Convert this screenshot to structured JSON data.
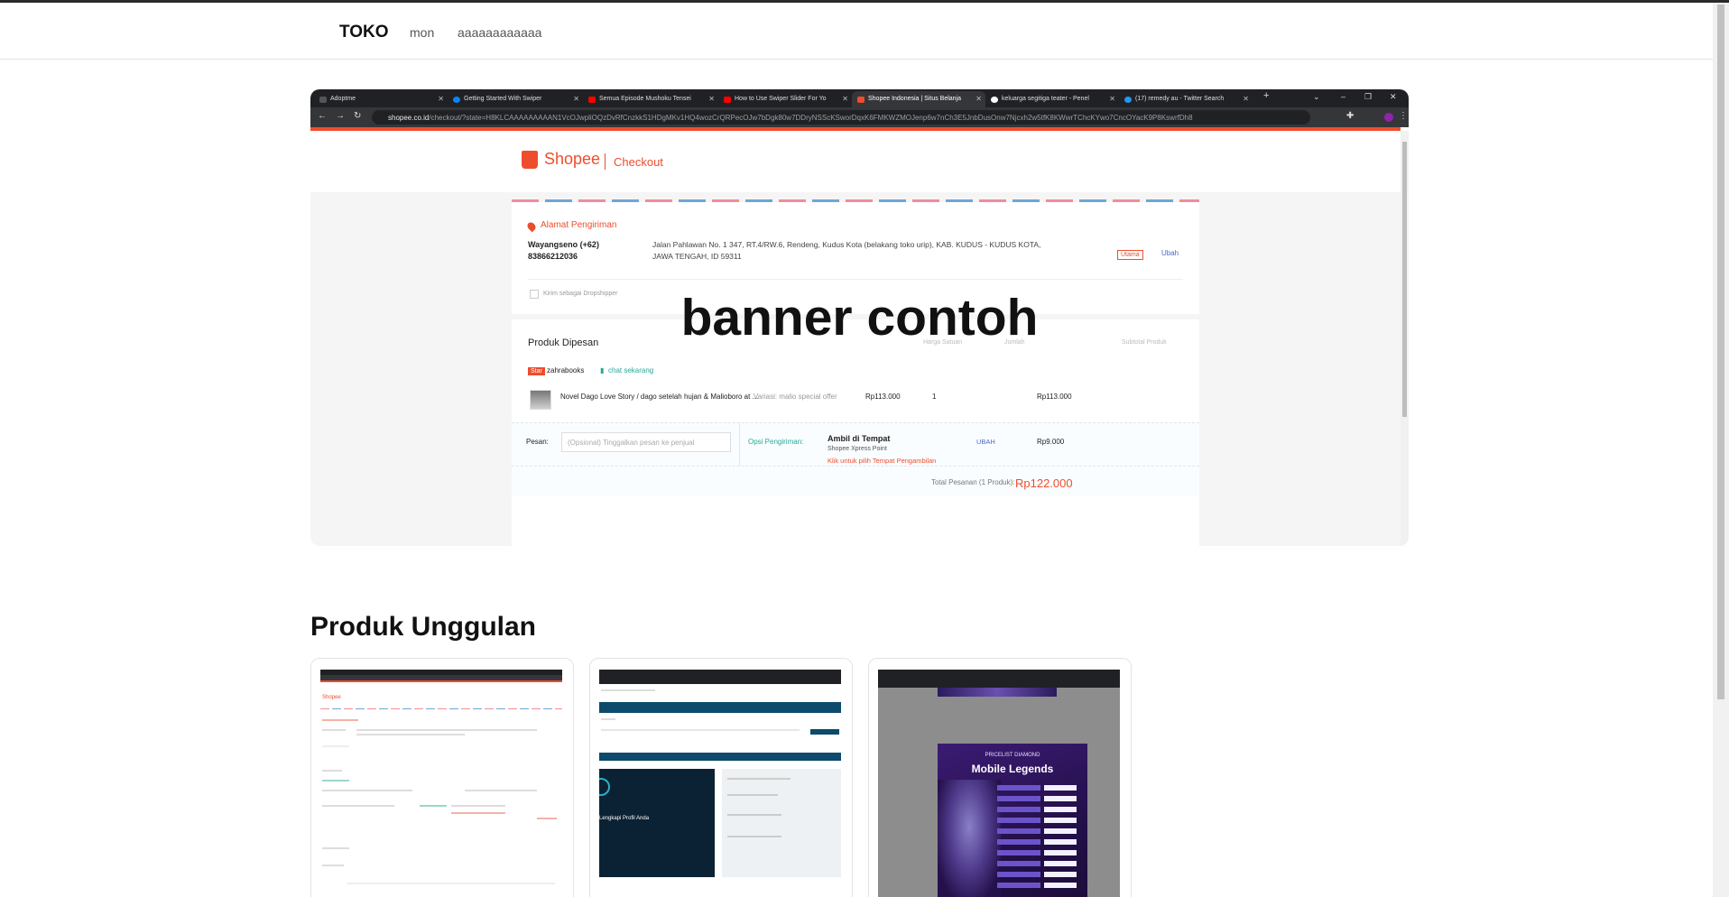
{
  "navbar": {
    "brand": "TOKO",
    "links": [
      "mon",
      "aaaaaaaaaaaa"
    ]
  },
  "banner": {
    "caption": "banner contoh",
    "browser": {
      "tabs": [
        "Adoptme",
        "Getting Started With Swiper",
        "Semua Episode Mushoku Tensei",
        "How to Use Swiper Slider For Yo",
        "Shopee Indonesia | Situs Belanja",
        "keluarga segitiga teater - Penel",
        "(17) remedy au - Twitter Search"
      ],
      "url_host": "shopee.co.id",
      "url_path": "/checkout/?state=H8KLCAAAAAAAAAN1VcOJwpliOQzDvRfCnzkkS1HDgMKv1HQ4wozCrQRPecOJw7bDgk80w7DDryNSScKSworDqxK6FMKWZMOJenp6w7nCh3E5JnbDusOnw7Njcxh2w5tfK8KWwrTChcKYwo7CncOYacK9P8KswrfDh8"
    },
    "checkout": {
      "brand": "Shopee",
      "page": "Checkout",
      "address_heading": "Alamat Pengiriman",
      "recipient_name": "Wayangseno (+62)",
      "recipient_phone": "83866212036",
      "address": "Jalan Pahlawan No. 1 347, RT.4/RW.6, Rendeng, Kudus Kota (belakang toko urip), KAB. KUDUS - KUDUS KOTA,",
      "address_line2": "JAWA TENGAH, ID 59311",
      "badge_utama": "Utama",
      "ubah": "Ubah",
      "dropshipper": "Kirim sebagai Dropshipper",
      "products_heading": "Produk Dipesan",
      "col_price": "Harga Satuan",
      "col_qty": "Jumlah",
      "col_subtotal": "Subtotal Produk",
      "shop_badge": "Star",
      "shop_name": "zahrabooks",
      "chat": "chat sekarang",
      "product_name": "Novel Dago Love Story / dago setelah hujan & Malioboro at ...",
      "variant": "Variasi: malio special offer",
      "unit_price": "Rp113.000",
      "qty": "1",
      "subtotal": "Rp113.000",
      "message_label": "Pesan:",
      "message_placeholder": "(Opsional) Tinggalkan pesan ke penjual",
      "shipping_option_label": "Opsi Pengiriman:",
      "shipping_method": "Ambil di Tempat",
      "shipping_sub": "Shopee Xpress Point",
      "shipping_link": "Klik untuk pilih Tempat Pengambilan",
      "shipping_change": "UBAH",
      "shipping_price": "Rp9.000",
      "order_total_label": "Total Pesanan (1 Produk):",
      "order_total": "Rp122.000"
    }
  },
  "featured": {
    "title": "Produk Unggulan",
    "cards": [
      {
        "name": "product-card-shopee-checkout"
      },
      {
        "name": "product-card-profile"
      },
      {
        "name": "product-card-mobile-legends",
        "poster_sub": "PRICELIST DIAMOND",
        "poster_title": "Mobile Legends"
      }
    ],
    "card2_text": "Lengkapi Profil Anda"
  },
  "colors": {
    "shopee_orange": "#ee4d2d",
    "browser_dark": "#202124",
    "text_dark": "#111111"
  }
}
